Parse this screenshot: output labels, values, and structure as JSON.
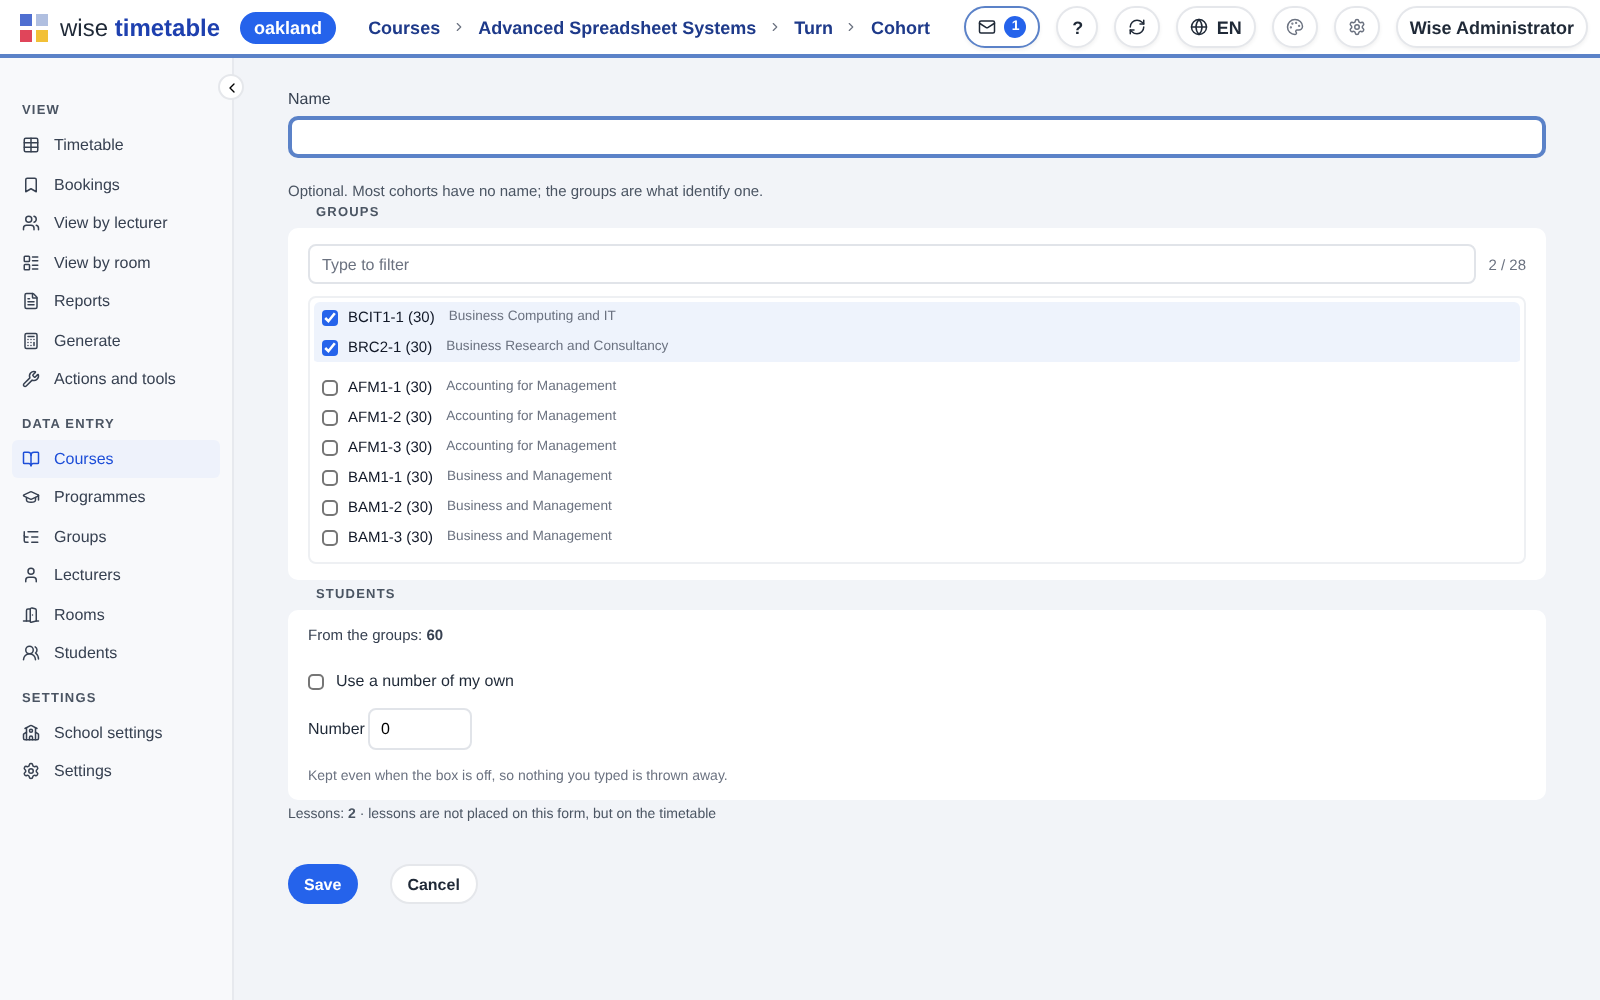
{
  "header": {
    "logo": {
      "light": "wise",
      "bold": "timetable"
    },
    "school_badge": "oakland",
    "breadcrumbs": [
      "Courses",
      "Advanced Spreadsheet Systems",
      "Turn",
      "Cohort"
    ],
    "notifications_count": "1",
    "help": "?",
    "language": "EN",
    "user": "Wise Administrator"
  },
  "sidebar": {
    "sections": [
      {
        "title": "VIEW",
        "items": [
          {
            "label": "Timetable",
            "selected": false
          },
          {
            "label": "Bookings",
            "selected": false
          },
          {
            "label": "View by lecturer",
            "selected": false
          },
          {
            "label": "View by room",
            "selected": false
          },
          {
            "label": "Reports",
            "selected": false
          },
          {
            "label": "Generate",
            "selected": false
          },
          {
            "label": "Actions and tools",
            "selected": false
          }
        ]
      },
      {
        "title": "DATA ENTRY",
        "items": [
          {
            "label": "Courses",
            "selected": true
          },
          {
            "label": "Programmes",
            "selected": false
          },
          {
            "label": "Groups",
            "selected": false
          },
          {
            "label": "Lecturers",
            "selected": false
          },
          {
            "label": "Rooms",
            "selected": false
          },
          {
            "label": "Students",
            "selected": false
          }
        ]
      },
      {
        "title": "SETTINGS",
        "items": [
          {
            "label": "School settings",
            "selected": false
          },
          {
            "label": "Settings",
            "selected": false
          }
        ]
      }
    ]
  },
  "form": {
    "name_label": "Name",
    "name_hint": "Optional. Most cohorts have no name; the groups are what identify one.",
    "groups": {
      "title": "GROUPS",
      "filter_placeholder": "Type to filter",
      "count": "2 / 28",
      "items": [
        {
          "code": "BCIT1-1 (30)",
          "name": "Business Computing and IT",
          "checked": true
        },
        {
          "code": "BRC2-1 (30)",
          "name": "Business Research and Consultancy",
          "checked": true
        },
        {
          "code": "AFM1-1 (30)",
          "name": "Accounting for Management",
          "checked": false
        },
        {
          "code": "AFM1-2 (30)",
          "name": "Accounting for Management",
          "checked": false
        },
        {
          "code": "AFM1-3 (30)",
          "name": "Accounting for Management",
          "checked": false
        },
        {
          "code": "BAM1-1 (30)",
          "name": "Business and Management",
          "checked": false
        },
        {
          "code": "BAM1-2 (30)",
          "name": "Business and Management",
          "checked": false
        },
        {
          "code": "BAM1-3 (30)",
          "name": "Business and Management",
          "checked": false
        }
      ]
    },
    "students": {
      "title": "STUDENTS",
      "from_groups": "From the groups: **60**",
      "own_number": {
        "label": "Use a number of my own",
        "checked": false
      },
      "number_label": "Number",
      "number_value": "0",
      "note": "Kept even when the box is off, so nothing you typed is thrown away."
    },
    "lessons_note": "Lessons: **2** · lessons are not placed on this form, but on the timetable",
    "buttons": {
      "save": "Save",
      "cancel": "Cancel"
    }
  }
}
